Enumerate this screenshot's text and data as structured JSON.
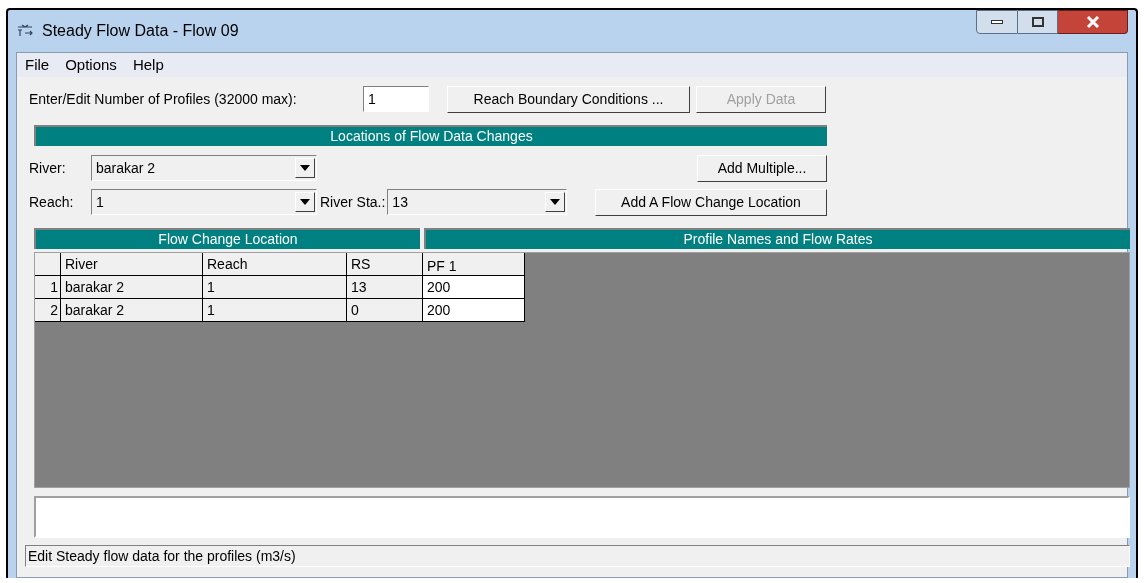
{
  "window": {
    "title": "Steady Flow Data - Flow 09"
  },
  "menu": [
    "File",
    "Options",
    "Help"
  ],
  "profiles": {
    "label": "Enter/Edit Number of Profiles (32000 max):",
    "value": "1"
  },
  "top_buttons": [
    {
      "label": "Reach Boundary Conditions ...",
      "disabled": false
    },
    {
      "label": "Apply Data",
      "disabled": true
    }
  ],
  "locations": {
    "title": "Locations of Flow Data Changes",
    "river": {
      "label": "River:",
      "value": "barakar 2"
    },
    "reach": {
      "label": "Reach:",
      "value": "1"
    },
    "river_sta": {
      "label": "River Sta.:",
      "value": "13"
    },
    "add_multiple": "Add Multiple...",
    "add_location": "Add A Flow Change Location"
  },
  "table": {
    "left_title": "Flow Change Location",
    "right_title": "Profile Names and Flow Rates",
    "columns": [
      "River",
      "Reach",
      "RS",
      "PF 1"
    ],
    "rows": [
      {
        "index": "1",
        "cells": [
          "barakar 2",
          "1",
          "13",
          "200"
        ]
      },
      {
        "index": "2",
        "cells": [
          "barakar 2",
          "1",
          "0",
          "200"
        ]
      }
    ]
  },
  "status_bar": "Edit Steady flow data for the profiles (m3/s)"
}
